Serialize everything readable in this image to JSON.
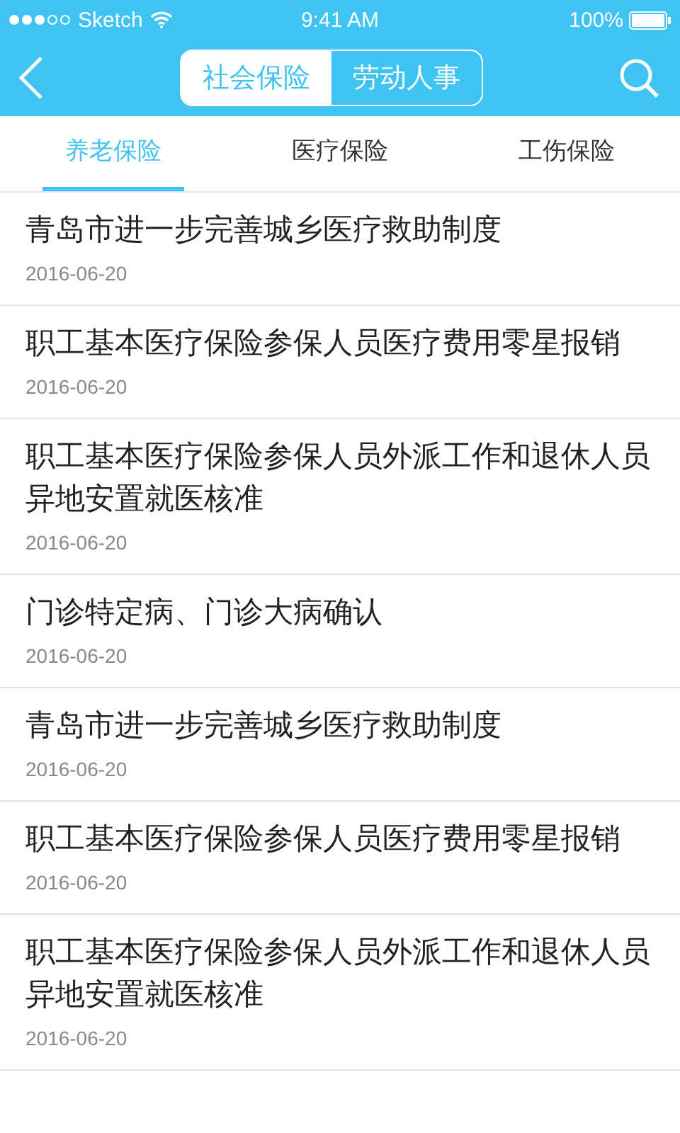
{
  "status_bar": {
    "carrier": "Sketch",
    "time": "9:41 AM",
    "battery": "100%"
  },
  "nav": {
    "segments": [
      {
        "label": "社会保险",
        "selected": true
      },
      {
        "label": "劳动人事",
        "selected": false
      }
    ]
  },
  "tabs": [
    {
      "label": "养老保险",
      "selected": true
    },
    {
      "label": "医疗保险",
      "selected": false
    },
    {
      "label": "工伤保险",
      "selected": false
    }
  ],
  "articles": [
    {
      "title": "青岛市进一步完善城乡医疗救助制度",
      "date": "2016-06-20"
    },
    {
      "title": "职工基本医疗保险参保人员医疗费用零星报销",
      "date": "2016-06-20"
    },
    {
      "title": "职工基本医疗保险参保人员外派工作和退休人员异地安置就医核准",
      "date": "2016-06-20"
    },
    {
      "title": "门诊特定病、门诊大病确认",
      "date": "2016-06-20"
    },
    {
      "title": "青岛市进一步完善城乡医疗救助制度",
      "date": "2016-06-20"
    },
    {
      "title": "职工基本医疗保险参保人员医疗费用零星报销",
      "date": "2016-06-20"
    },
    {
      "title": "职工基本医疗保险参保人员外派工作和退休人员异地安置就医核准",
      "date": "2016-06-20"
    }
  ]
}
